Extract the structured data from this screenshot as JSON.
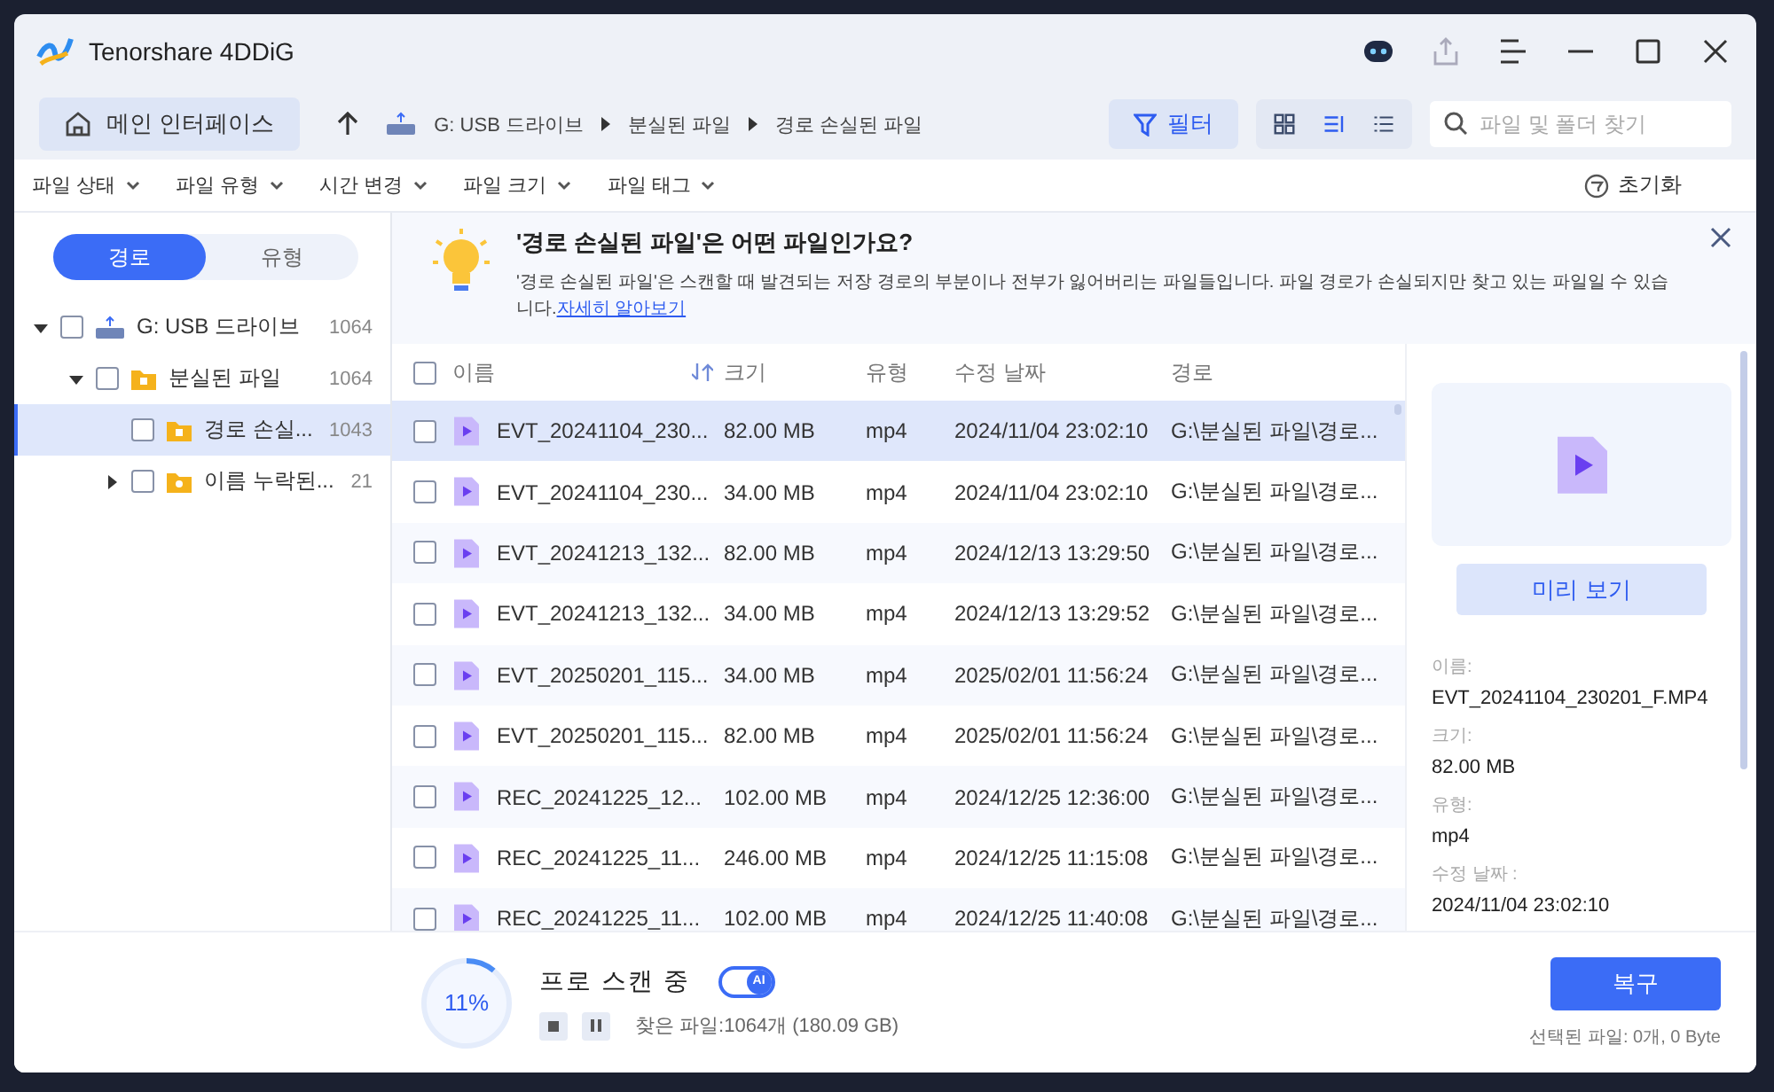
{
  "window": {
    "title": "Tenorshare 4DDiG"
  },
  "toolbar": {
    "home_button": "메인 인터페이스",
    "breadcrumb": [
      "G: USB 드라이브",
      "분실된 파일",
      "경로 손실된 파일"
    ],
    "filter_button": {
      "label": "필터",
      "selected": true
    },
    "views": [
      {
        "kind": "grid",
        "selected": false
      },
      {
        "kind": "detail",
        "selected": true
      },
      {
        "kind": "list",
        "selected": false
      }
    ],
    "search": {
      "placeholder": "파일 및 폴더 찾기"
    }
  },
  "filters": {
    "items": [
      "파일 상태",
      "파일 유형",
      "시간 변경",
      "파일 크기",
      "파일 태그"
    ],
    "reset": "초기화"
  },
  "sidebar": {
    "tabs": [
      {
        "label": "경로",
        "selected": true
      },
      {
        "label": "유형",
        "selected": false
      }
    ],
    "tree": [
      {
        "label": "G: USB 드라이브",
        "count": "1064",
        "kind": "drive",
        "expanded": true,
        "checked": false,
        "selected": false,
        "children": [
          {
            "label": "분실된 파일",
            "count": "1064",
            "kind": "trash",
            "expanded": true,
            "checked": false,
            "selected": false,
            "children": [
              {
                "label": "경로 손실...",
                "count": "1043",
                "kind": "lost",
                "checked": false,
                "selected": true
              },
              {
                "label": "이름 누락된...",
                "count": "21",
                "kind": "noname",
                "expanded": false,
                "checked": false,
                "selected": false
              }
            ]
          }
        ]
      }
    ]
  },
  "banner": {
    "title": "'경로 손실된 파일'은 어떤 파일인가요?",
    "text": "'경로 손실된 파일'은 스캔할 때 발견되는 저장 경로의 부분이나 전부가 잃어버리는 파일들입니다. 파일 경로가 손실되지만 찾고 있는 파일일 수 있습니다.",
    "link": "자세히 알아보기"
  },
  "table": {
    "columns": [
      "이름",
      "크기",
      "유형",
      "수정 날짜",
      "경로"
    ],
    "all_checked": false,
    "rows": [
      {
        "name": "EVT_20241104_230...",
        "size": "82.00 MB",
        "type": "mp4",
        "date": "2024/11/04 23:02:10",
        "path": "G:\\분실된 파일\\경로...",
        "checked": false,
        "selected": true
      },
      {
        "name": "EVT_20241104_230...",
        "size": "34.00 MB",
        "type": "mp4",
        "date": "2024/11/04 23:02:10",
        "path": "G:\\분실된 파일\\경로...",
        "checked": false,
        "selected": false
      },
      {
        "name": "EVT_20241213_132...",
        "size": "82.00 MB",
        "type": "mp4",
        "date": "2024/12/13 13:29:50",
        "path": "G:\\분실된 파일\\경로...",
        "checked": false,
        "selected": false
      },
      {
        "name": "EVT_20241213_132...",
        "size": "34.00 MB",
        "type": "mp4",
        "date": "2024/12/13 13:29:52",
        "path": "G:\\분실된 파일\\경로...",
        "checked": false,
        "selected": false
      },
      {
        "name": "EVT_20250201_115...",
        "size": "34.00 MB",
        "type": "mp4",
        "date": "2025/02/01 11:56:24",
        "path": "G:\\분실된 파일\\경로...",
        "checked": false,
        "selected": false
      },
      {
        "name": "EVT_20250201_115...",
        "size": "82.00 MB",
        "type": "mp4",
        "date": "2025/02/01 11:56:24",
        "path": "G:\\분실된 파일\\경로...",
        "checked": false,
        "selected": false
      },
      {
        "name": "REC_20241225_12...",
        "size": "102.00 MB",
        "type": "mp4",
        "date": "2024/12/25 12:36:00",
        "path": "G:\\분실된 파일\\경로...",
        "checked": false,
        "selected": false
      },
      {
        "name": "REC_20241225_11...",
        "size": "246.00 MB",
        "type": "mp4",
        "date": "2024/12/25 11:15:08",
        "path": "G:\\분실된 파일\\경로...",
        "checked": false,
        "selected": false
      },
      {
        "name": "REC_20241225_11...",
        "size": "102.00 MB",
        "type": "mp4",
        "date": "2024/12/25 11:40:08",
        "path": "G:\\분실된 파일\\경로...",
        "checked": false,
        "selected": false
      }
    ]
  },
  "preview": {
    "button": "미리 보기",
    "fields": [
      {
        "label": "이름:",
        "value": "EVT_20241104_230201_F.MP4"
      },
      {
        "label": "크기:",
        "value": "82.00 MB"
      },
      {
        "label": "유형:",
        "value": "mp4"
      },
      {
        "label": "수정 날짜 :",
        "value": "2024/11/04 23:02:10"
      }
    ]
  },
  "status": {
    "progress": {
      "level": 0.11,
      "text": "11%"
    },
    "title": "프로 스캔 중",
    "ai_toggle": {
      "on": true,
      "label": "AI"
    },
    "found": "찾은 파일:1064개 (180.09 GB)",
    "recover_button": "복구",
    "selected_info": "선택된 파일: 0개, 0 Byte"
  }
}
